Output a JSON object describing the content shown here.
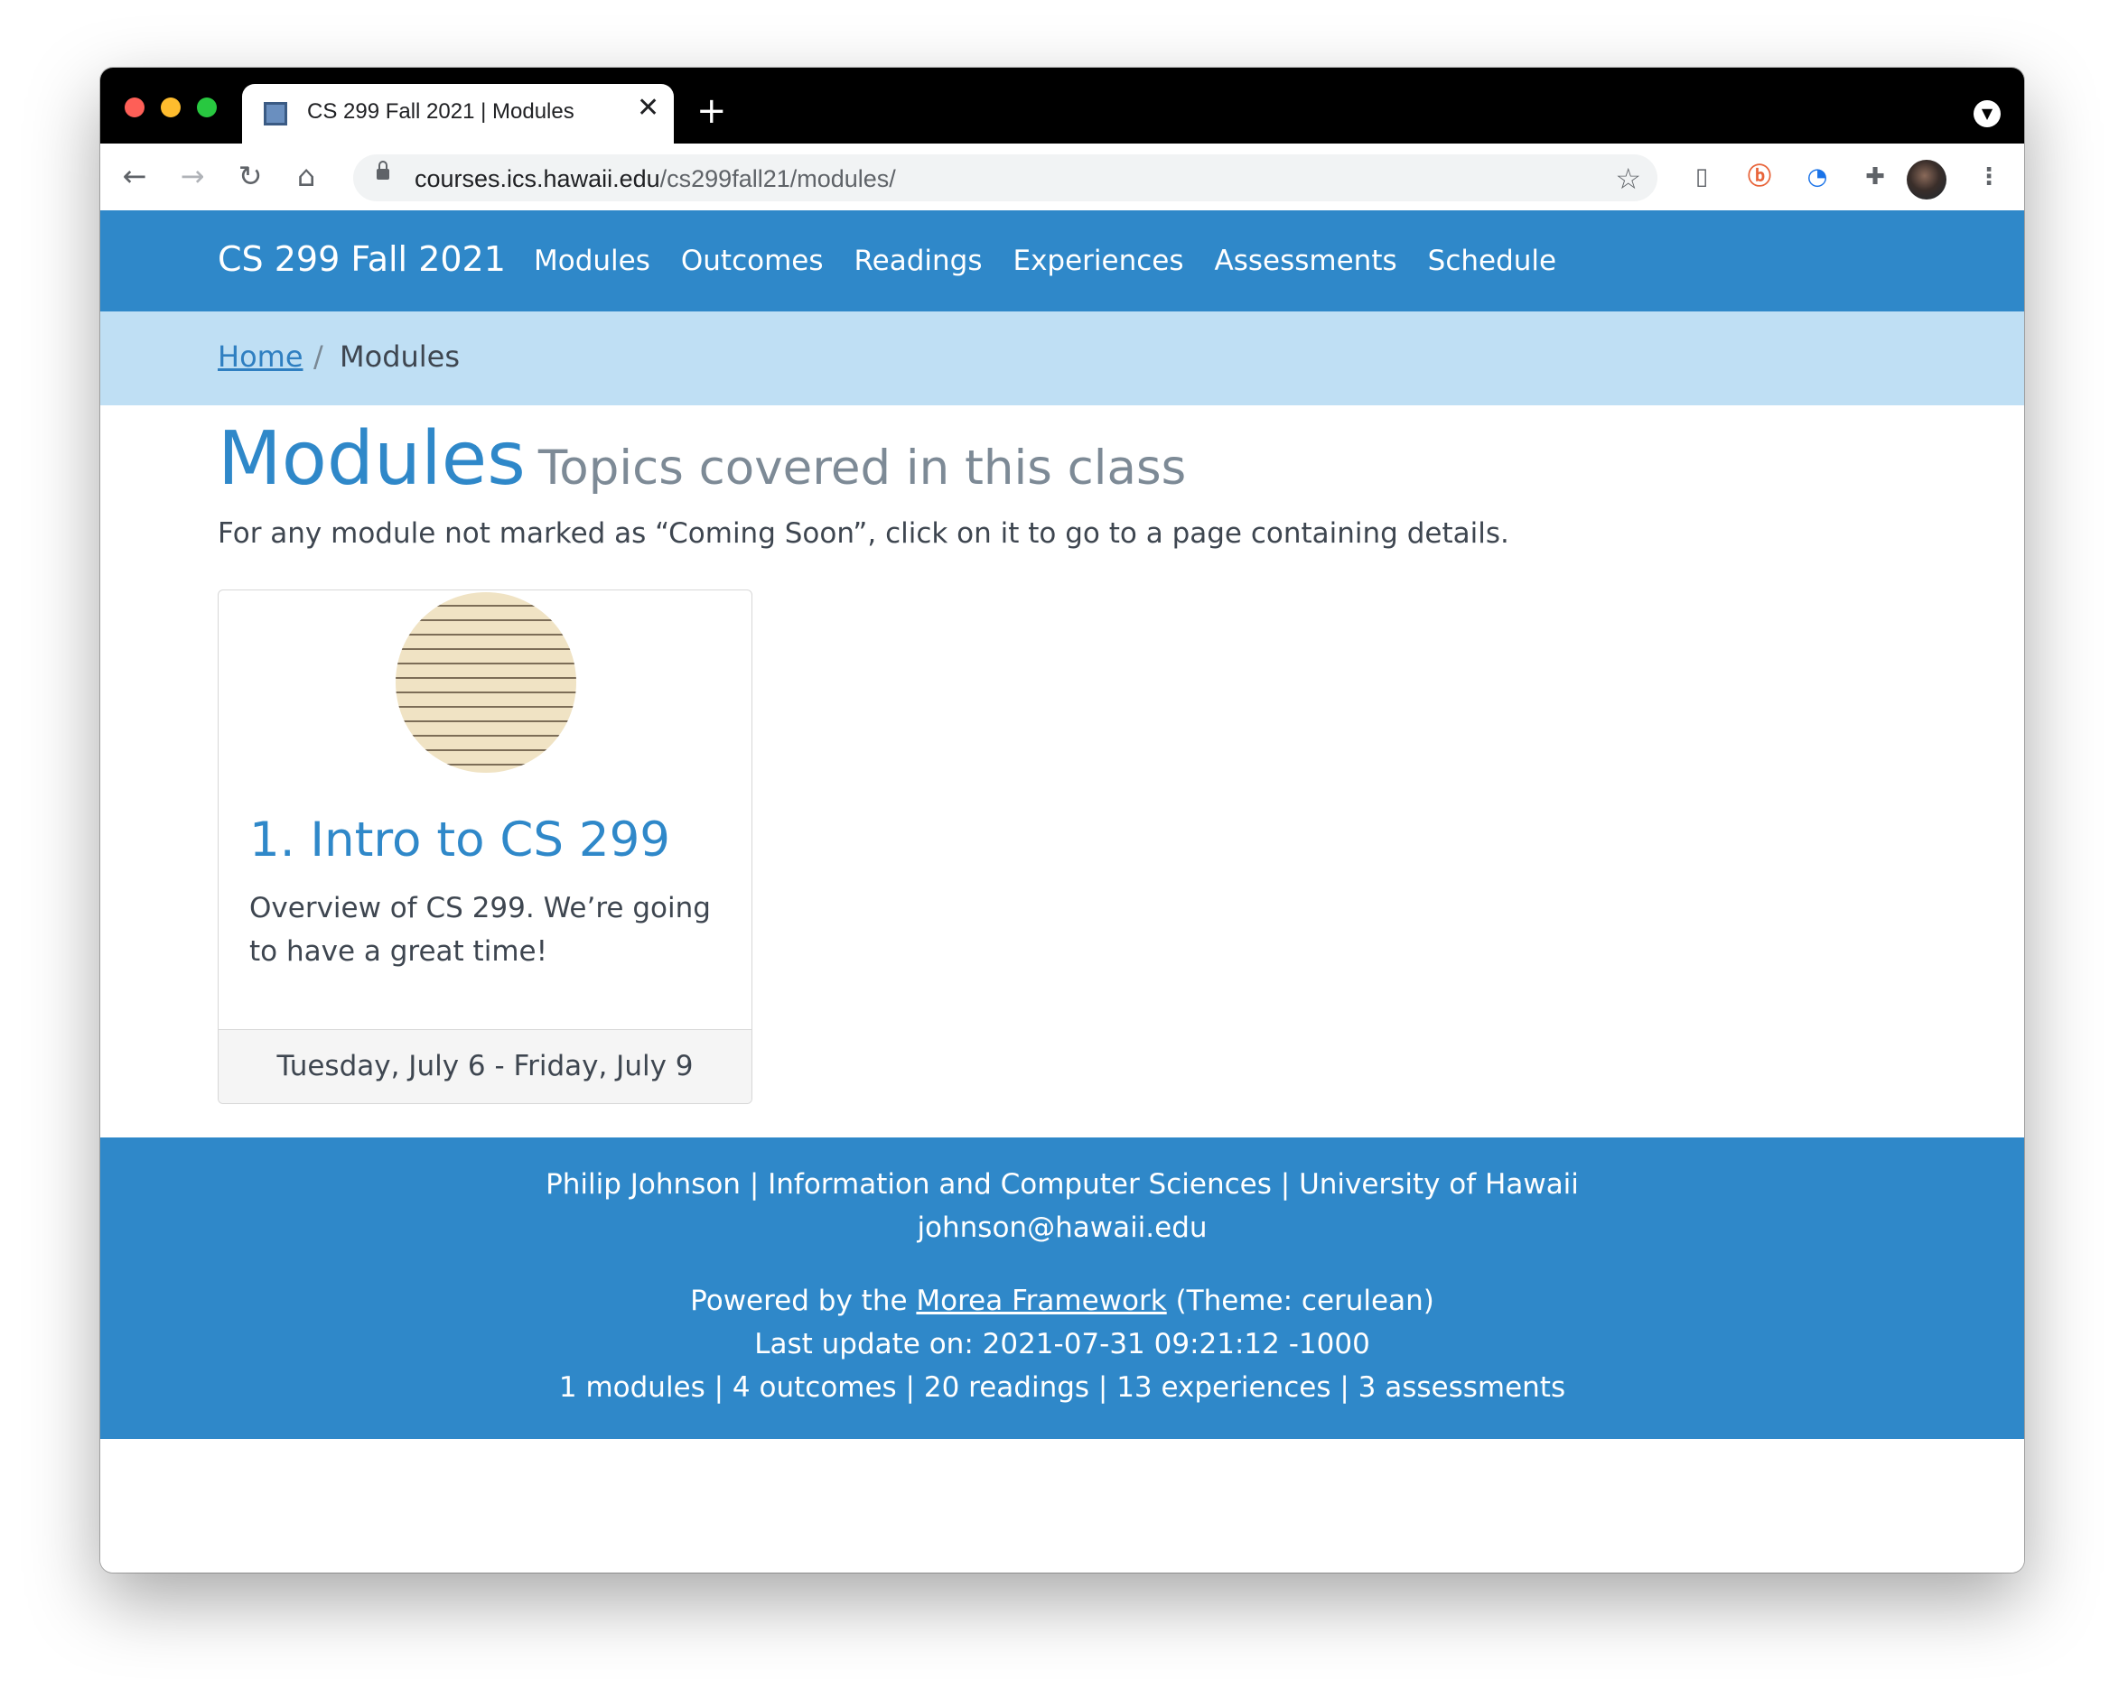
{
  "browser": {
    "tab_title": "CS 299 Fall 2021 | Modules",
    "new_tab": "+",
    "close": "✕",
    "url_host": "courses.ics.hawaii.edu",
    "url_path": "/cs299fall21/modules/"
  },
  "navbar": {
    "brand": "CS 299 Fall 2021",
    "links": [
      "Modules",
      "Outcomes",
      "Readings",
      "Experiences",
      "Assessments",
      "Schedule"
    ]
  },
  "breadcrumb": {
    "home": "Home",
    "separator": "/",
    "current": "Modules"
  },
  "page": {
    "title": "Modules",
    "subtitle": "Topics covered in this class",
    "intro": "For any module not marked as “Coming Soon”, click on it to go to a page containing details."
  },
  "modules": [
    {
      "title": "1. Intro to CS 299",
      "description": "Overview of CS 299. We’re going to have a great time!",
      "dates": "Tuesday, July 6 - Friday, July 9"
    }
  ],
  "footer": {
    "author": "Philip Johnson",
    "department": "Information and Computer Sciences",
    "university": "University of Hawaii",
    "separator": "|",
    "email": "johnson@hawaii.edu",
    "powered_prefix": "Powered by the",
    "powered_link": "Morea Framework",
    "powered_suffix": "(Theme: cerulean)",
    "last_update": "Last update on: 2021-07-31 09:21:12 -1000",
    "stats": "1 modules | 4 outcomes | 20 readings | 13 experiences | 3 assessments"
  },
  "colors": {
    "navbar": "#2f88c9",
    "breadcrumb_bg": "#bfdff4",
    "link": "#2f7fc1"
  }
}
